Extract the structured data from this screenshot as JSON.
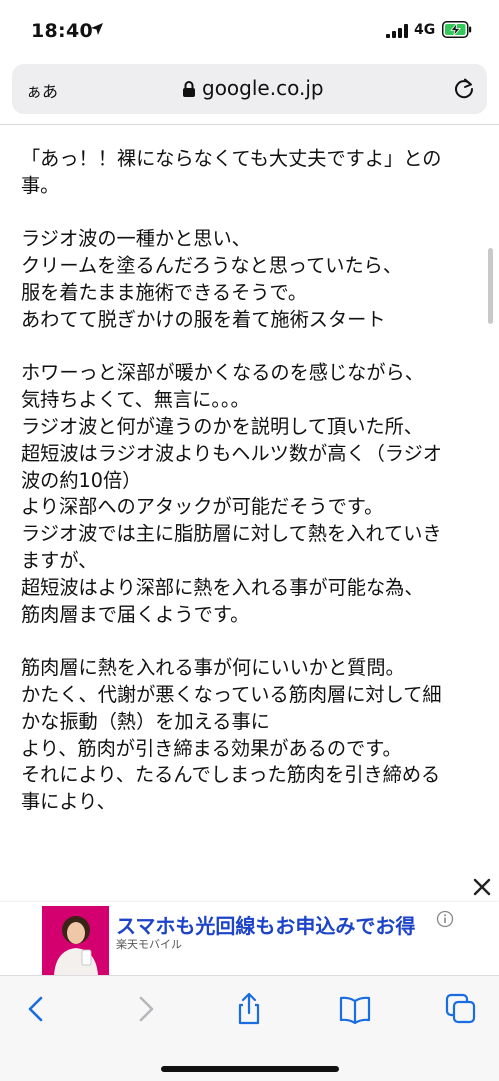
{
  "status": {
    "time": "18:40",
    "network": "4G"
  },
  "address_bar": {
    "text_size_label": "ぁあ",
    "url": "google.co.jp"
  },
  "article": {
    "lines": [
      "「あっ！！裸にならなくても大丈夫ですよ」との",
      "事。",
      "",
      "ラジオ波の一種かと思い、",
      "クリームを塗るんだろうなと思っていたら、",
      "服を着たまま施術できるそうで。",
      "あわてて脱ぎかけの服を着て施術スタート",
      "",
      "ホワーっと深部が暖かくなるのを感じながら、",
      "気持ちよくて、無言に。。。",
      "ラジオ波と何が違うのかを説明して頂いた所、",
      "超短波はラジオ波よりもヘルツ数が高く（ラジオ",
      "波の約10倍）",
      "より深部へのアタックが可能だそうです。",
      "ラジオ波では主に脂肪層に対して熱を入れていき",
      "ますが、",
      "超短波はより深部に熱を入れる事が可能な為、",
      "筋肉層まで届くようです。",
      "",
      "筋肉層に熱を入れる事が何にいいかと質問。",
      "かたく、代謝が悪くなっている筋肉層に対して細",
      "かな振動（熱）を加える事に",
      "より、筋肉が引き締まる効果があるのです。",
      "それにより、たるんでしまった筋肉を引き締める",
      "事により、"
    ]
  },
  "ad": {
    "title": "スマホも光回線もお申込みでお得",
    "advertiser": "楽天モバイル"
  },
  "toolbar": {
    "icons": [
      "back-icon",
      "forward-icon",
      "share-icon",
      "bookmarks-icon",
      "tabs-icon"
    ]
  },
  "colors": {
    "ad_title": "#1d43c8",
    "ad_image_bg": "#d4006f",
    "battery_fill": "#34c759"
  }
}
